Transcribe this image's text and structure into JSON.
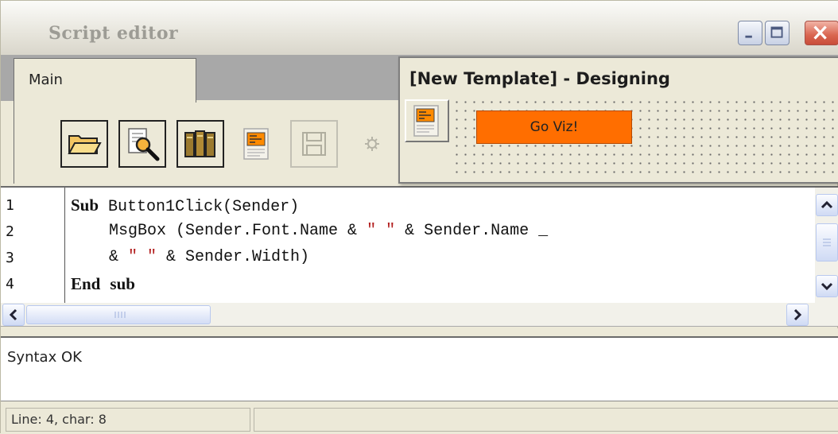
{
  "window": {
    "title": "Script editor"
  },
  "tabs": [
    {
      "label": "Main"
    }
  ],
  "toolbar": [
    {
      "icon": "folder-open-icon",
      "enabled": true
    },
    {
      "icon": "search-document-icon",
      "enabled": true
    },
    {
      "icon": "library-books-icon",
      "enabled": true
    },
    {
      "icon": "form-icon",
      "enabled": true
    },
    {
      "icon": "save-icon",
      "enabled": false
    },
    {
      "icon": "gear-icon",
      "enabled": false
    }
  ],
  "editor": {
    "line_numbers": [
      "1",
      "2",
      "3",
      "4"
    ],
    "lines": [
      [
        "Sub",
        " Button1Click(Sender)"
      ],
      [
        "    MsgBox (Sender.Font.Name & ",
        "\" \"",
        " & Sender.Name _"
      ],
      [
        "    & ",
        "\" \"",
        " & Sender.Width)"
      ],
      [
        "End",
        " ",
        "sub"
      ]
    ]
  },
  "output": {
    "text": "Syntax OK"
  },
  "status": {
    "position": "Line: 4, char: 8"
  },
  "designer": {
    "title": "[New Template] - Designing",
    "button_label": "Go Viz!",
    "button_color": "#ff6e00"
  }
}
